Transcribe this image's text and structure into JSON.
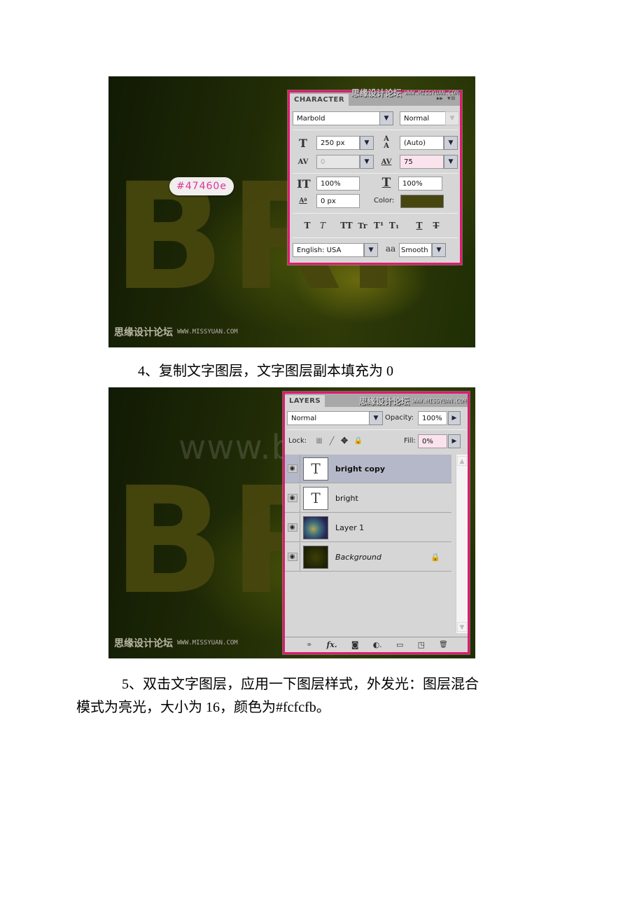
{
  "screenshot1": {
    "canvas_text": "BRI",
    "color_callout": "#47460e",
    "site_watermark": {
      "cn": "思缘设计论坛",
      "url": "WWW.MISSYUAN.COM"
    },
    "character_panel": {
      "tab_label": "CHARACTER",
      "header_controls": {
        "expand": "▸▸",
        "menu": "▾≡"
      },
      "font_family": "Marbold",
      "font_style": "Normal",
      "font_size": "250 px",
      "leading": "(Auto)",
      "kerning": "0",
      "tracking": "75",
      "vertical_scale": "100%",
      "horizontal_scale": "100%",
      "baseline_shift": "0 px",
      "color_label": "Color:",
      "color_value": "#47460e",
      "style_buttons": [
        "T",
        "T",
        "TT",
        "Tr",
        "T¹",
        "T₁",
        "T",
        "T"
      ],
      "language": "English: USA",
      "antialias_label": "aa",
      "antialias": "Smooth"
    }
  },
  "caption_step4": "4、复制文字图层，文字图层副本填充为 0",
  "screenshot2": {
    "canvas_text": "BRI",
    "watermark_web": "www.bdocx.com",
    "site_watermark": {
      "cn": "思缘设计论坛",
      "url": "WWW.MISSYUAN.COM"
    },
    "layers_panel": {
      "tab_label": "LAYERS",
      "blend_mode": "Normal",
      "opacity_label": "Opacity:",
      "opacity": "100%",
      "lock_label": "Lock:",
      "fill_label": "Fill:",
      "fill": "0%",
      "layers": [
        {
          "name": "bright copy",
          "type": "text",
          "selected": true
        },
        {
          "name": "bright",
          "type": "text",
          "selected": false
        },
        {
          "name": "Layer 1",
          "type": "image",
          "selected": false
        },
        {
          "name": "Background",
          "type": "background",
          "selected": false,
          "locked": true
        }
      ],
      "footer_icons": [
        "link-icon",
        "fx-icon",
        "mask-icon",
        "adjustment-icon",
        "folder-icon",
        "new-layer-icon",
        "trash-icon"
      ],
      "footer_glyphs": {
        "link": "⚭",
        "fx": "fx.",
        "mask": "◙",
        "adjust": "◐.",
        "folder": "▭",
        "new": "◳",
        "trash": "🗑"
      }
    },
    "site_watermark_header": {
      "cn": "思缘设计论坛",
      "url": "WWW.MISSYUAN.COM"
    }
  },
  "caption_step5_line1": "5、双击文字图层，应用一下图层样式，外发光：图层混合",
  "caption_step5_line2": "模式为亮光，大小为 16，颜色为#fcfcfb。"
}
